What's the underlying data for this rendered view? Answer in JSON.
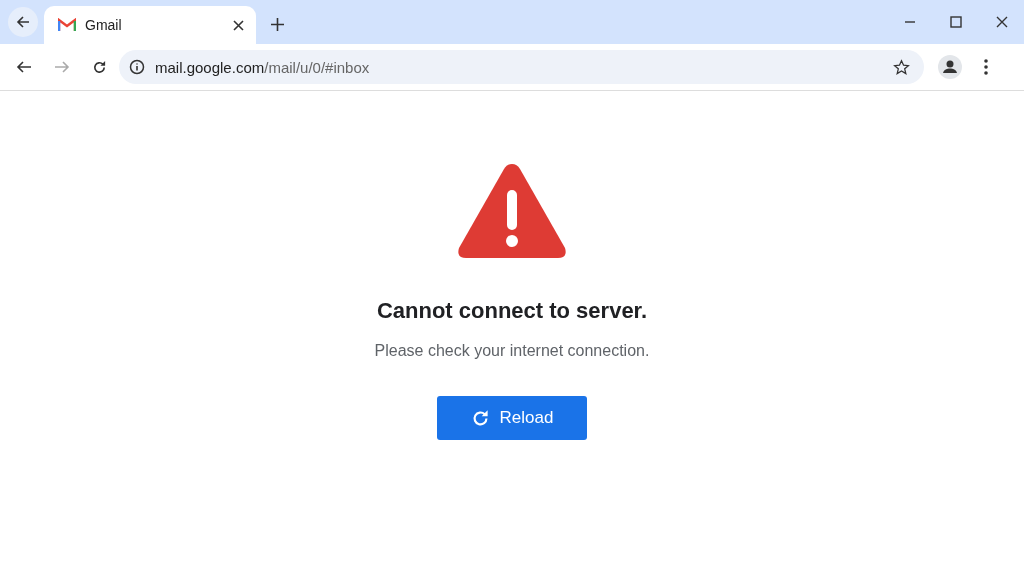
{
  "tabs": [
    {
      "title": "Gmail",
      "selected": true
    }
  ],
  "toolbar": {
    "back_disabled": false,
    "forward_disabled": true
  },
  "address": {
    "host": "mail.google.com",
    "path": "/mail/u/0/#inbox"
  },
  "error": {
    "title": "Cannot connect to server.",
    "message": "Please check your internet connection.",
    "button": "Reload"
  }
}
